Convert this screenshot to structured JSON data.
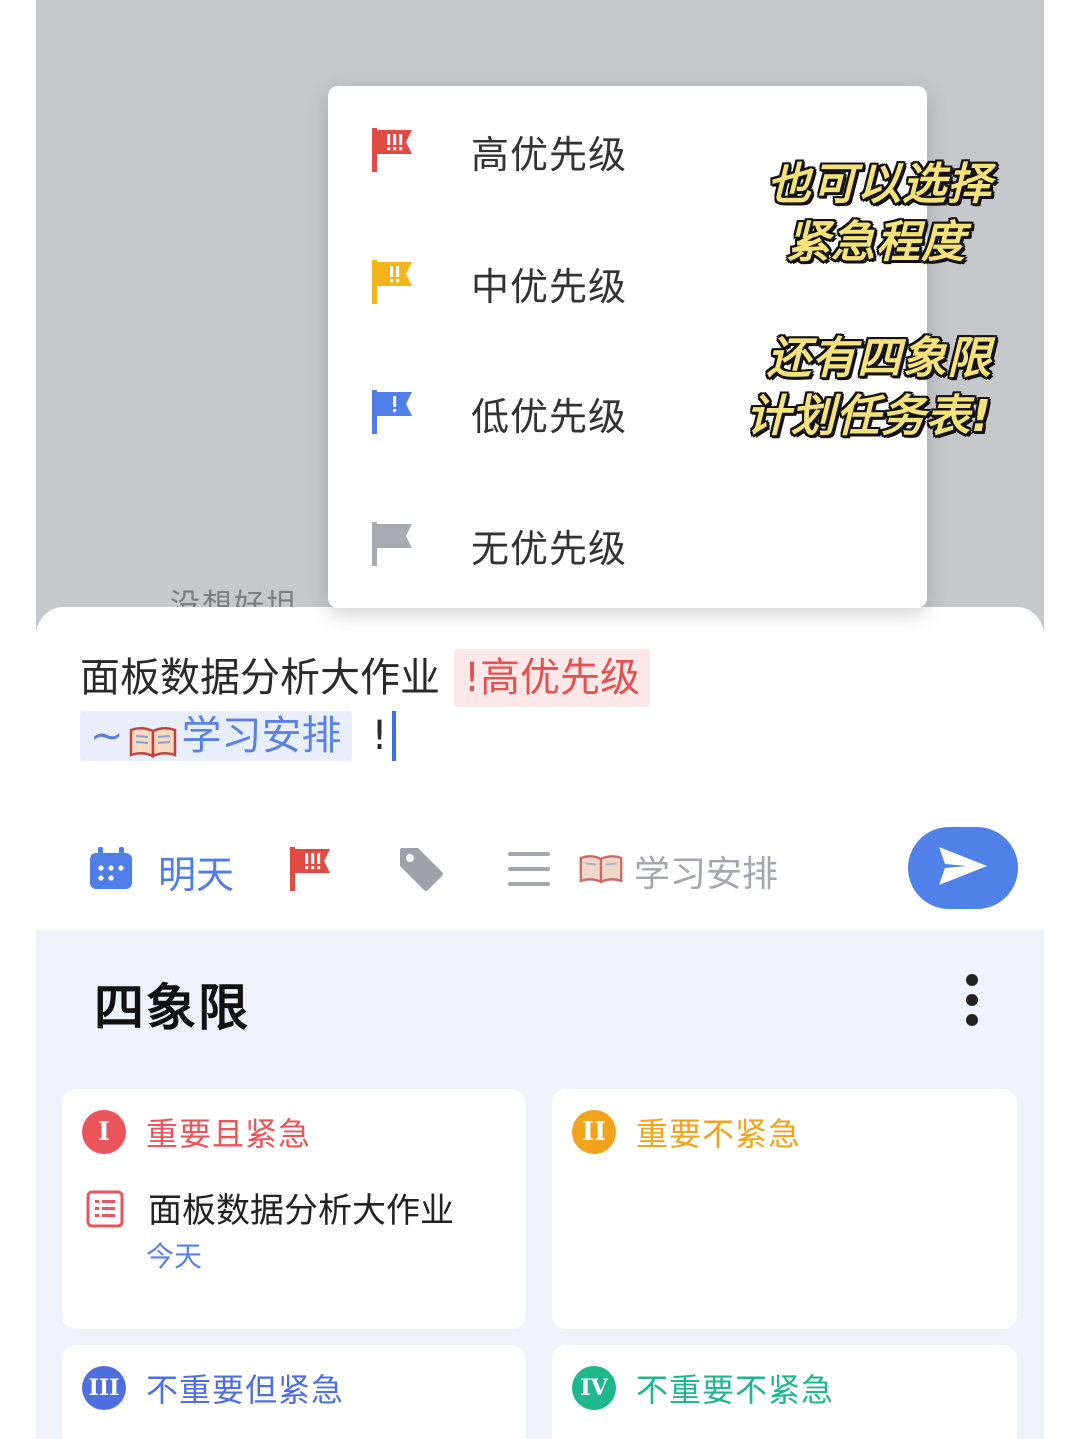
{
  "background": {
    "peek_text": "没想好坦"
  },
  "priority_menu": {
    "items": [
      {
        "label": "高优先级",
        "flag": "flag-icon",
        "color": "#e24a44",
        "mark": "!!!"
      },
      {
        "label": "中优先级",
        "flag": "flag-icon",
        "color": "#f2b418",
        "mark": "!!"
      },
      {
        "label": "低优先级",
        "flag": "flag-icon",
        "color": "#4f7ee8",
        "mark": "!"
      },
      {
        "label": "无优先级",
        "flag": "flag-icon",
        "color": "#a9abb0",
        "mark": ""
      }
    ]
  },
  "captions": {
    "first": [
      "也可以选择",
      "紧急程度"
    ],
    "second": [
      "还有四象限",
      "计划任务表!"
    ]
  },
  "task_input": {
    "title": "面板数据分析大作业",
    "priority_chip": "!高优先级",
    "list_chip_prefix": "~",
    "list_chip_icon": "book-icon",
    "list_chip_name": "学习安排",
    "typed_tail": "!"
  },
  "toolbar": {
    "date_label": "明天",
    "list_label": "学习安排",
    "accent": "#4f81e9"
  },
  "quadrant_panel": {
    "title": "四象限",
    "quadrants": [
      {
        "badge": "I",
        "title": "重要且紧急",
        "color": "#e9555a",
        "tasks": [
          {
            "title": "面板数据分析大作业",
            "due": "今天"
          }
        ]
      },
      {
        "badge": "II",
        "title": "重要不紧急",
        "color": "#f2a31c",
        "tasks": []
      },
      {
        "badge": "III",
        "title": "不重要但紧急",
        "color": "#4f6fe0",
        "tasks": []
      },
      {
        "badge": "IV",
        "title": "不重要不紧急",
        "color": "#1fb88a",
        "tasks": []
      }
    ]
  }
}
